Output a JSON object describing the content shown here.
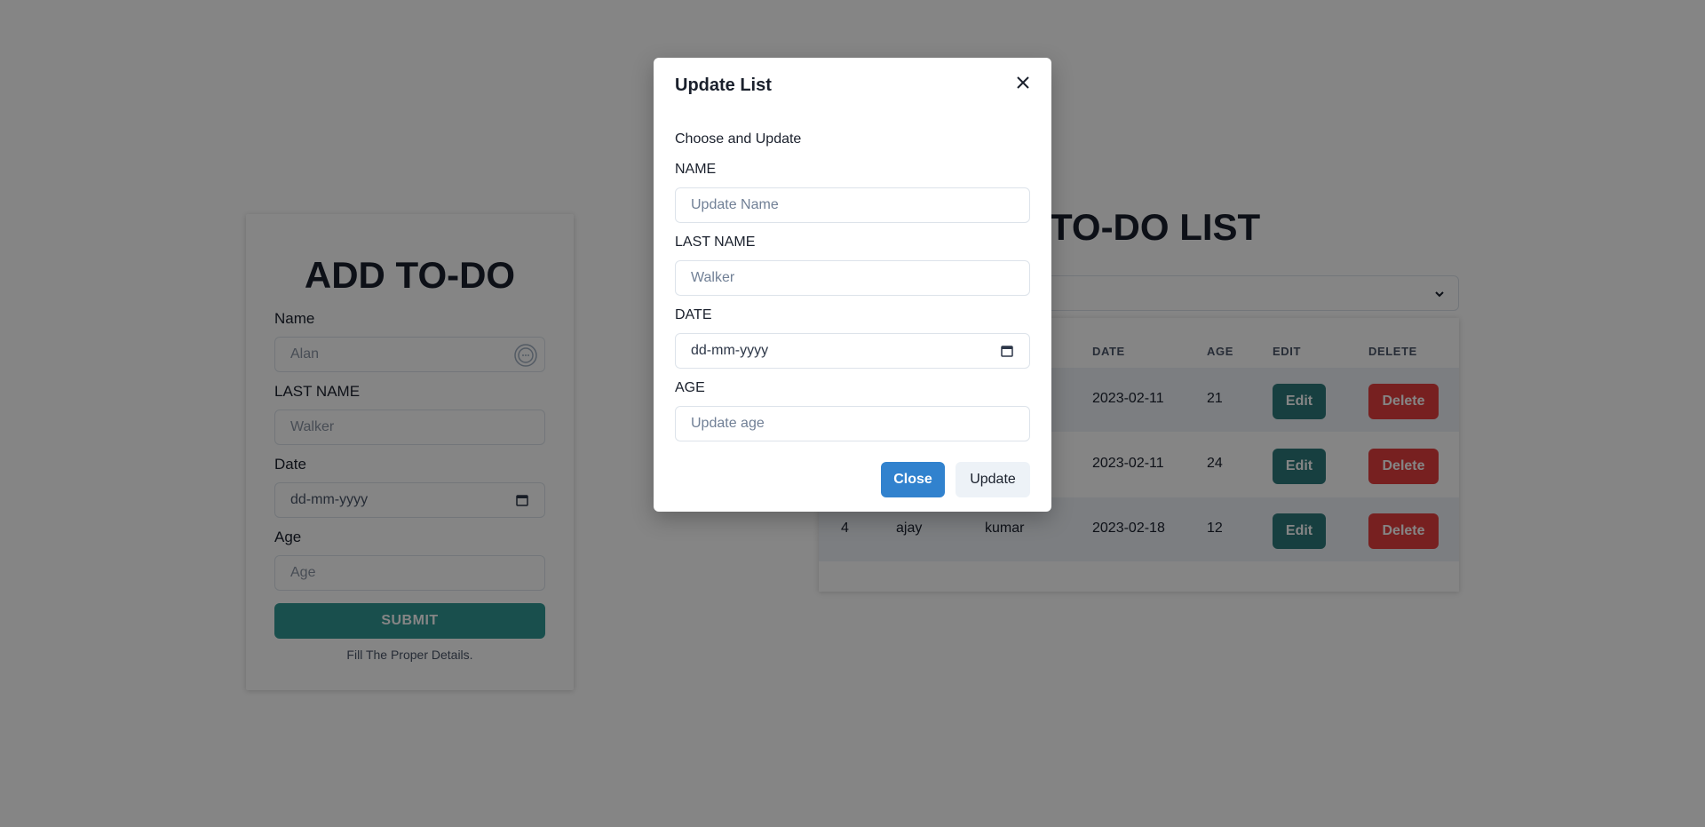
{
  "add_form": {
    "title": "ADD TO-DO",
    "name_label": "Name",
    "name_placeholder": "Alan",
    "lastname_label": "LAST NAME",
    "lastname_placeholder": "Walker",
    "date_label": "Date",
    "date_placeholder": "dd-mm-yyyy",
    "age_label": "Age",
    "age_placeholder": "Age",
    "submit_label": "SUBMIT",
    "helper_text": "Fill The Proper Details."
  },
  "list": {
    "title": "TO-DO LIST",
    "headers": {
      "date": "DATE",
      "age": "AGE",
      "edit": "EDIT",
      "delete": "DELETE"
    },
    "rows": [
      {
        "id": "",
        "name": "",
        "lastname": "",
        "date": "2023-02-11",
        "age": "21",
        "edit": "Edit",
        "delete": "Delete"
      },
      {
        "id": "",
        "name": "",
        "lastname": "",
        "date": "2023-02-11",
        "age": "24",
        "edit": "Edit",
        "delete": "Delete"
      },
      {
        "id": "4",
        "name": "ajay",
        "lastname": "kumar",
        "date": "2023-02-18",
        "age": "12",
        "edit": "Edit",
        "delete": "Delete"
      }
    ]
  },
  "modal": {
    "title": "Update List",
    "subtitle": "Choose and Update",
    "name_label": "NAME",
    "name_placeholder": "Update Name",
    "lastname_label": "LAST NAME",
    "lastname_placeholder": "Walker",
    "date_label": "DATE",
    "date_placeholder": "dd-mm-yyyy",
    "age_label": "AGE",
    "age_placeholder": "Update age",
    "close_label": "Close",
    "update_label": "Update"
  },
  "colors": {
    "teal": "#319795",
    "edit": "#2c7a7b",
    "delete": "#e53e3e",
    "close_blue": "#3182ce"
  }
}
